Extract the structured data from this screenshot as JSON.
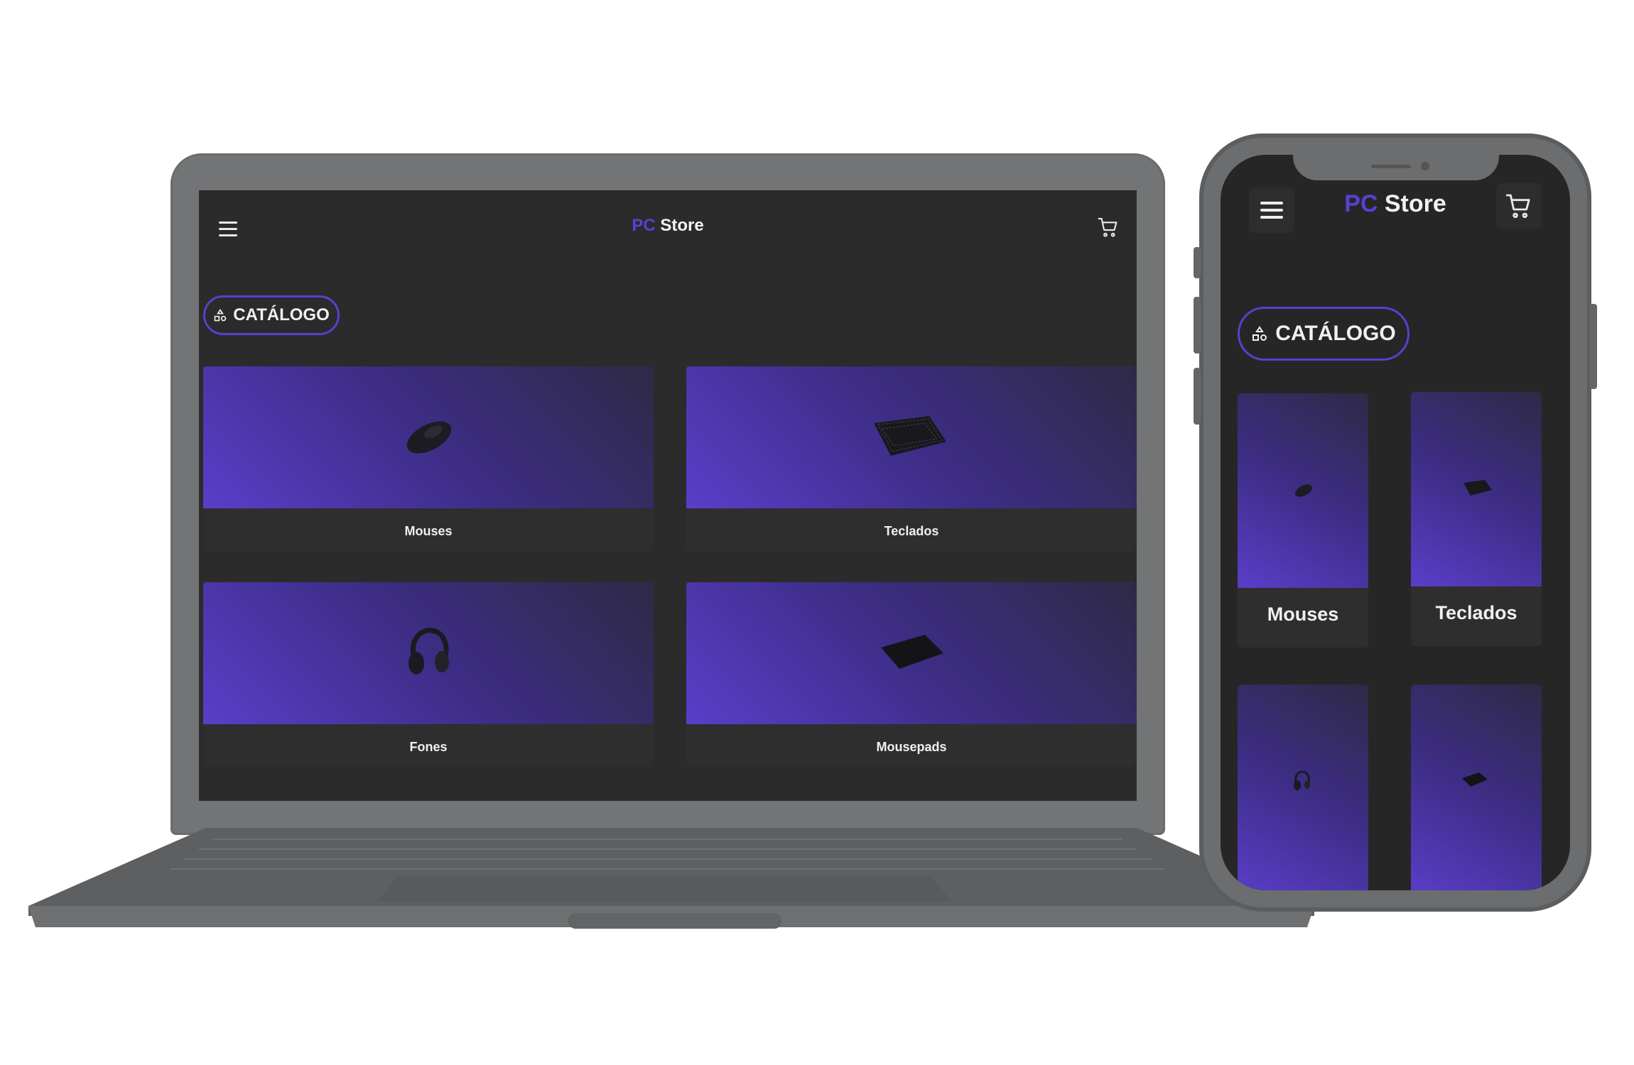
{
  "brand": {
    "prefix": "PC",
    "name": "Store",
    "accent": "#5b3fd6"
  },
  "catalog_button": {
    "label": "CATÁLOGO",
    "icon": "shapes-icon"
  },
  "icons": {
    "menu": "hamburger-menu-icon",
    "cart": "shopping-cart-icon"
  },
  "categories": [
    {
      "label": "Mouses",
      "product_icon": "mouse-icon"
    },
    {
      "label": "Teclados",
      "product_icon": "keyboard-icon"
    },
    {
      "label": "Fones",
      "product_icon": "headphones-icon"
    },
    {
      "label": "Mousepads",
      "product_icon": "mousepad-icon"
    }
  ],
  "colors": {
    "background": "#2b2b2b",
    "card": "#2e2e2e",
    "gradient_start": "#5a3ec9",
    "gradient_end": "#2e2a45"
  }
}
